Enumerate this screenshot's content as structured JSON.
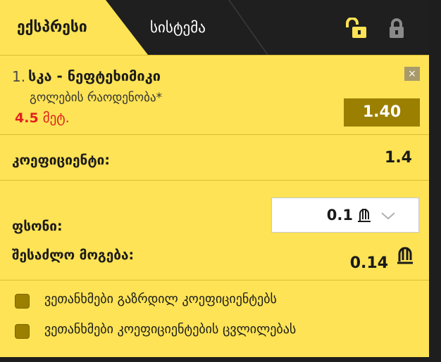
{
  "tabs": {
    "express_label": "ექსპრესი",
    "system_label": "სისტემა"
  },
  "icons": {
    "lock_open": "lock-open-icon",
    "lock_closed": "lock-closed-icon",
    "lock_open_color": "#fde355",
    "lock_closed_color": "#8a8a8a"
  },
  "bet": {
    "number": "1.",
    "title": "სკა - ნეფტეხიმიკი",
    "market": "გოლების რაოდენობა*",
    "selection_value": "4.5",
    "selection_unit": "მეტ.",
    "odd": "1.40",
    "close_symbol": "×"
  },
  "summary": {
    "coef_label": "კოეფიციენტი:",
    "coef_value": "1.4",
    "stake_label": "ფსონი:",
    "stake_value": "0.1",
    "win_label": "შესაძლო მოგება:",
    "win_value": "0.14"
  },
  "options": [
    {
      "label": "ვეთანხმები გაზრდილ კოეფიციენტებს",
      "checked": false
    },
    {
      "label": "ვეთანხმები კოეფიციენტების ცვლილებას",
      "checked": false
    }
  ],
  "colors": {
    "panel_bg": "#fde355",
    "dark_bg": "#1f1f1f",
    "accent": "#9b7f00",
    "red": "#e02020"
  }
}
